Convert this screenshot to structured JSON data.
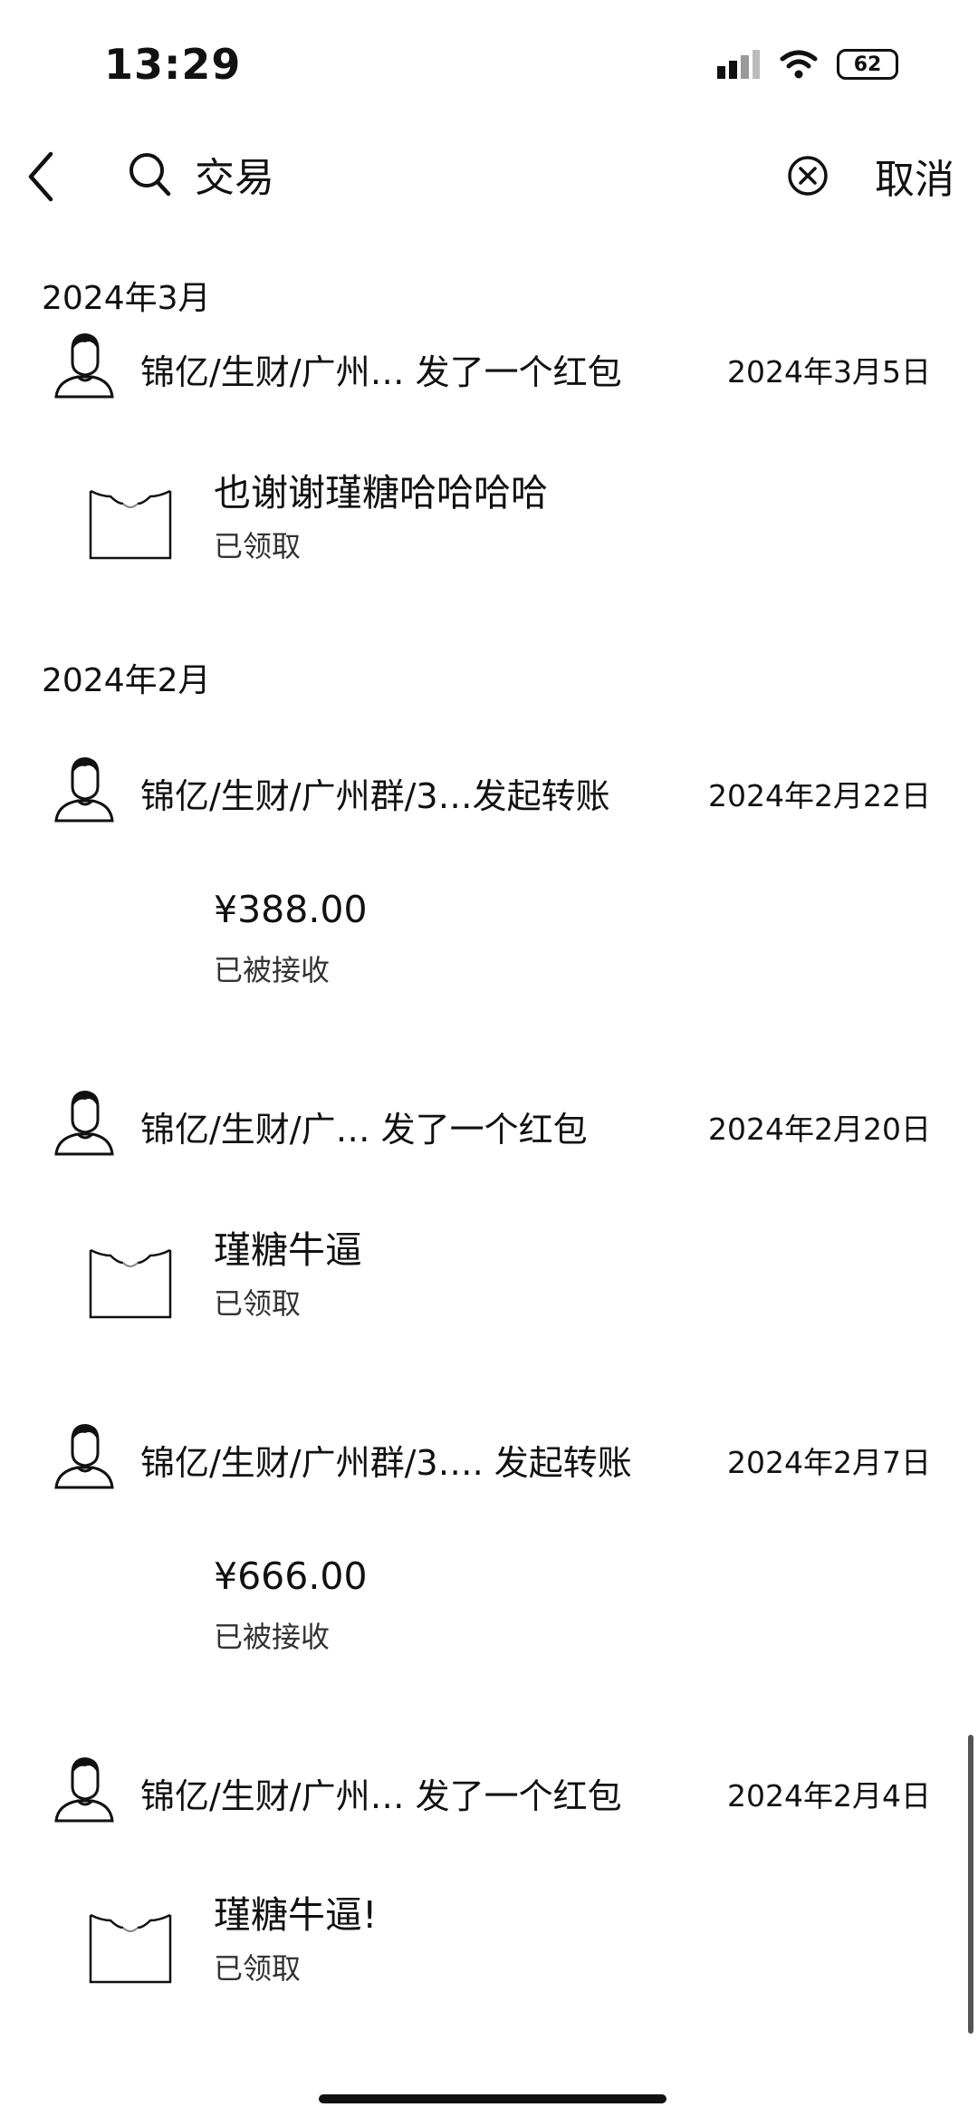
{
  "status_bar": {
    "time": "13:29",
    "battery": "62"
  },
  "search": {
    "query": "交易",
    "cancel_label": "取消"
  },
  "sections": [
    {
      "month": "2024年3月",
      "items": [
        {
          "title": "锦亿/生财/广州… 发了一个红包",
          "date": "2024年3月5日",
          "kind": "red-packet",
          "main": "也谢谢瑾糖哈哈哈哈",
          "sub": "已领取"
        }
      ]
    },
    {
      "month": "2024年2月",
      "items": [
        {
          "title": "锦亿/生财/广州群/3…发起转账",
          "date": "2024年2月22日",
          "kind": "transfer",
          "main": "¥388.00",
          "sub": "已被接收"
        },
        {
          "title": "锦亿/生财/广…  发了一个红包",
          "date": "2024年2月20日",
          "kind": "red-packet",
          "main": "瑾糖牛逼",
          "sub": "已领取"
        },
        {
          "title": "锦亿/生财/广州群/3…. 发起转账",
          "date": "2024年2月7日",
          "kind": "transfer",
          "main": "¥666.00",
          "sub": "已被接收"
        },
        {
          "title": "锦亿/生财/广州… 发了一个红包",
          "date": "2024年2月4日",
          "kind": "red-packet",
          "main": "瑾糖牛逼!",
          "sub": "已领取"
        }
      ]
    }
  ]
}
